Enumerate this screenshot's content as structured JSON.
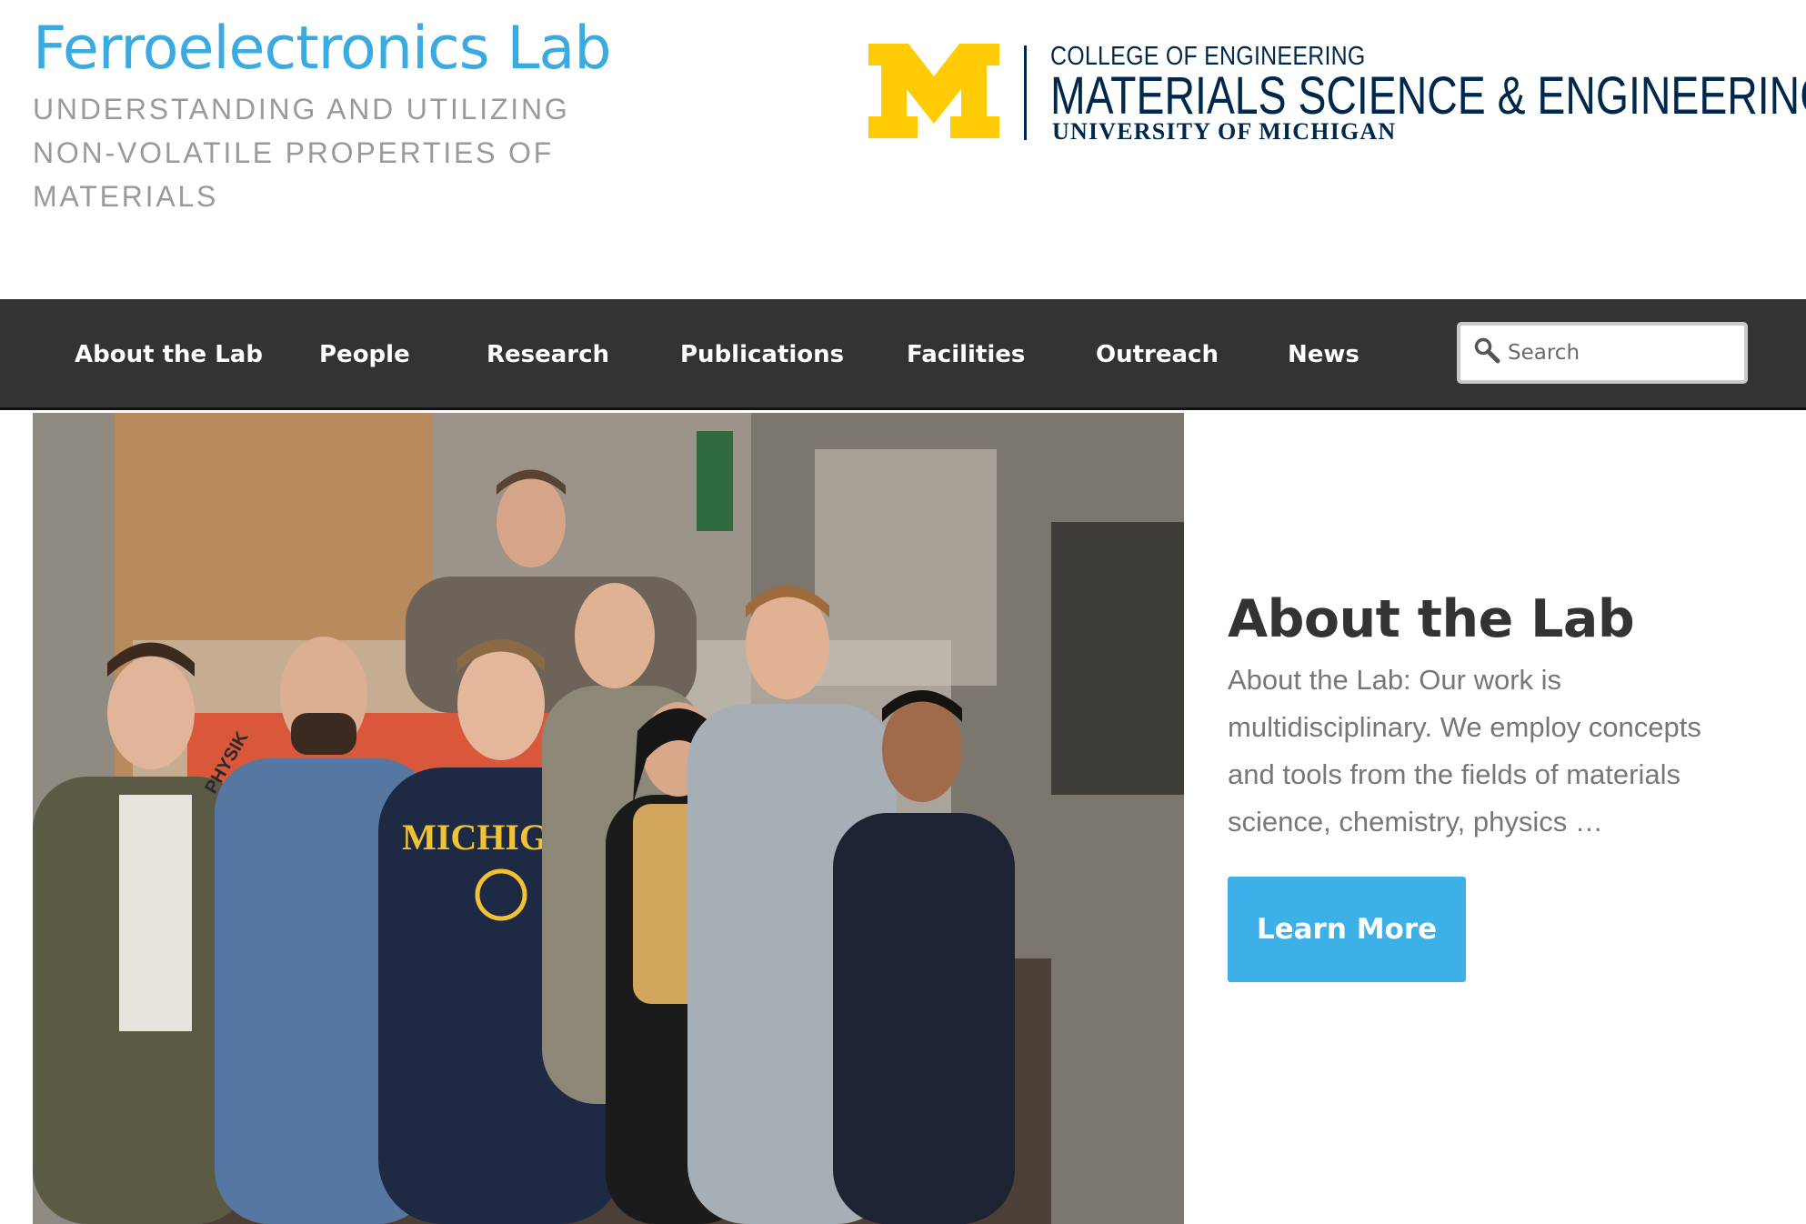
{
  "header": {
    "site_title": "Ferroelectronics Lab",
    "tagline": "UNDERSTANDING AND UTILIZING NON-VOLATILE PROPERTIES OF MATERIALS"
  },
  "logo": {
    "college": "COLLEGE OF ENGINEERING",
    "department": "MATERIALS SCIENCE & ENGINEERING",
    "university": "UNIVERSITY OF MICHIGAN",
    "colors": {
      "maize": "#ffcb05",
      "blue": "#00274c"
    }
  },
  "nav": {
    "items": [
      {
        "label": "About the Lab"
      },
      {
        "label": "People"
      },
      {
        "label": "Research"
      },
      {
        "label": "Publications"
      },
      {
        "label": "Facilities"
      },
      {
        "label": "Outreach"
      },
      {
        "label": "News"
      }
    ],
    "search": {
      "placeholder": "Search",
      "icon": "search-icon"
    }
  },
  "hero": {
    "photo": {
      "shirt_text": "MICHIGAN",
      "machine_text": "PHYSIK"
    },
    "heading": "About the Lab",
    "text": "About the Lab: Our work is multidisciplinary. We employ concepts and tools from the fields of materials science, chemistry, physics …",
    "button_label": "Learn More"
  },
  "colors": {
    "accent": "#3aabe0",
    "nav_bg": "#333333",
    "button": "#3eb0e8"
  }
}
